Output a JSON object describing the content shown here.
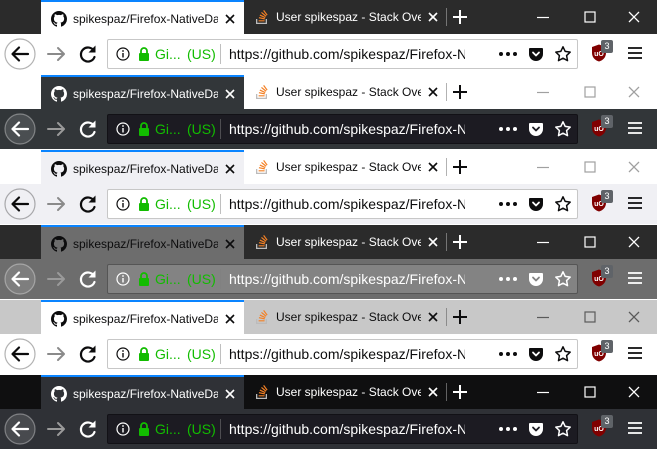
{
  "tabs": [
    {
      "title": "spikespaz/Firefox-NativeDark",
      "icon": "github-icon"
    },
    {
      "title": "User spikespaz - Stack Overflow",
      "icon": "stackoverflow-icon"
    }
  ],
  "urlbar": {
    "identity_label": "Gi...",
    "country": "(US)",
    "url": "https://github.com/spikespaz/Firefox-NativeDark"
  },
  "extension_badge": "3",
  "themes": [
    {
      "name": "light",
      "tabbar_bg": "#2b2b2b",
      "tab_sel_bg": "#ffffff",
      "tab_text": "#ffffff",
      "tab_sel_text": "#0c0c0d",
      "nav_bg": "#ffffff",
      "url_bg": "#ffffff",
      "url_text": "#0c0c0d",
      "icon": "#0c0c0d",
      "wc": "#ffffff"
    },
    {
      "name": "dark-light-tabs",
      "tabbar_bg": "#ffffff",
      "tab_sel_bg": "#323639",
      "tab_text": "#0c0c0d",
      "tab_sel_text": "#ffffff",
      "nav_bg": "#323639",
      "url_bg": "#1c1b22",
      "url_text": "#ffffff",
      "icon": "#ffffff",
      "wc": "#a0a0a0"
    },
    {
      "name": "light-white",
      "tabbar_bg": "#ffffff",
      "tab_sel_bg": "#f0f0f4",
      "tab_text": "#0c0c0d",
      "tab_sel_text": "#0c0c0d",
      "nav_bg": "#f0f0f4",
      "url_bg": "#ffffff",
      "url_text": "#0c0c0d",
      "icon": "#0c0c0d",
      "wc": "#a0a0a0"
    },
    {
      "name": "dark-gray",
      "tabbar_bg": "#2b2b2b",
      "tab_sel_bg": "#6d6d6d",
      "tab_text": "#ffffff",
      "tab_sel_text": "#0c0c0d",
      "nav_bg": "#6d6d6d",
      "url_bg": "#838383",
      "url_text": "#ffffff",
      "icon": "#ffffff",
      "wc": "#ffffff"
    },
    {
      "name": "light-on-gray",
      "tabbar_bg": "#c8c8c8",
      "tab_sel_bg": "#ffffff",
      "tab_text": "#0c0c0d",
      "tab_sel_text": "#0c0c0d",
      "nav_bg": "#ffffff",
      "url_bg": "#ffffff",
      "url_text": "#0c0c0d",
      "icon": "#0c0c0d",
      "wc": "#5a5a5a"
    },
    {
      "name": "dark",
      "tabbar_bg": "#0f0f10",
      "tab_sel_bg": "#2f3136",
      "tab_text": "#ffffff",
      "tab_sel_text": "#ffffff",
      "nav_bg": "#2f3136",
      "url_bg": "#1c1b22",
      "url_text": "#ffffff",
      "icon": "#ffffff",
      "wc": "#ffffff"
    }
  ]
}
